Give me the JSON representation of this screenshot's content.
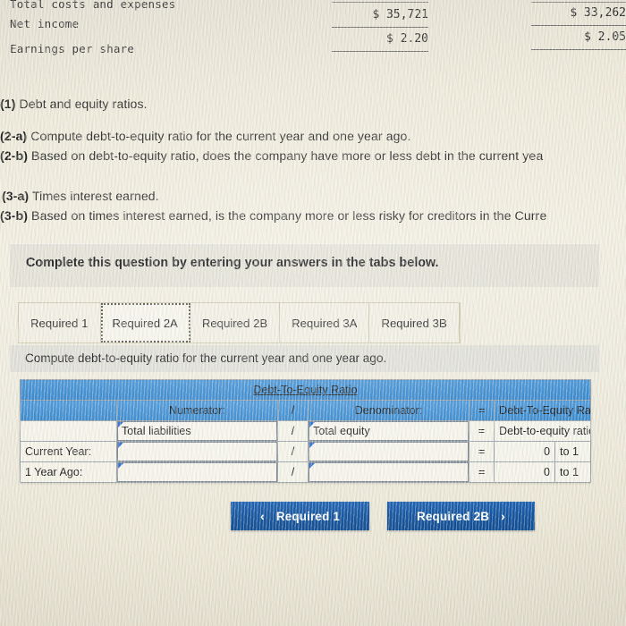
{
  "financial_statement": {
    "rows": [
      {
        "label": "Total costs and expenses",
        "current": "",
        "prior": ""
      },
      {
        "label": "Net income",
        "current": "$ 35,721",
        "prior": "$ 33,262"
      },
      {
        "label": "Earnings per share",
        "current": "$ 2.20",
        "prior": "$ 2.05"
      }
    ]
  },
  "questions": [
    {
      "num": "(1)",
      "text": "Debt and equity ratios."
    },
    {
      "num": "(2-a)",
      "text": "Compute debt-to-equity ratio for the current year and one year ago."
    },
    {
      "num": "(2-b)",
      "text": "Based on debt-to-equity ratio, does the company have more or less debt in the current yea"
    },
    {
      "num": "(3-a)",
      "text": "Times interest earned."
    },
    {
      "num": "(3-b)",
      "text": "Based on times interest earned, is the company more or less risky for creditors in the Curre"
    }
  ],
  "panel": {
    "banner_text": "Complete this question by entering your answers in the tabs below.",
    "tabs": [
      {
        "label": "Required 1",
        "active": false
      },
      {
        "label": "Required 2A",
        "active": true
      },
      {
        "label": "Required 2B",
        "active": false
      },
      {
        "label": "Required 3A",
        "active": false
      },
      {
        "label": "Required 3B",
        "active": false
      }
    ],
    "instruction": "Compute debt-to-equity ratio for the current year and one year ago."
  },
  "table": {
    "title": "Debt-To-Equity Ratio",
    "headers": {
      "row_label": "",
      "numerator": "Numerator:",
      "divide": "/",
      "denominator": "Denominator:",
      "equals": "=",
      "result": "Debt-To-Equity Ratio"
    },
    "formula_row": {
      "label": "",
      "numerator": "Total liabilities",
      "divide": "/",
      "denominator": "Total equity",
      "equals": "=",
      "result": "Debt-to-equity ratio"
    },
    "rows": [
      {
        "label": "Current Year:",
        "numerator": "",
        "divide": "/",
        "denominator": "",
        "equals": "=",
        "value": "0",
        "unit": "to 1"
      },
      {
        "label": "1 Year Ago:",
        "numerator": "",
        "divide": "/",
        "denominator": "",
        "equals": "=",
        "value": "0",
        "unit": "to 1"
      }
    ]
  },
  "navigation": {
    "prev_label": "Required 1",
    "prev_icon": "chevron-left",
    "prev_glyph": "‹",
    "next_label": "Required 2B",
    "next_icon": "chevron-right",
    "next_glyph": "›"
  },
  "colors": {
    "header_blue": "#3f8ed2",
    "button_blue": "#16569f",
    "marker_blue": "#2f6fd0",
    "paper": "#eeeadb",
    "grid_line": "#9aa3ac"
  }
}
